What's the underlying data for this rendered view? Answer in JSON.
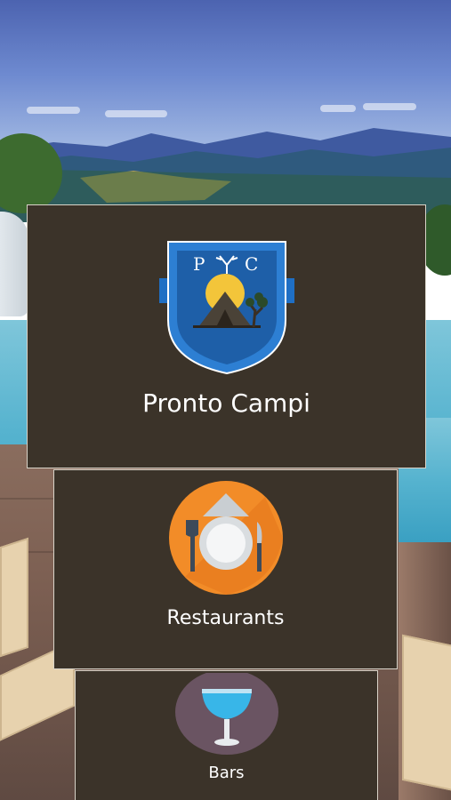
{
  "menu": {
    "items": [
      {
        "label": "Pronto Campi",
        "icon": "campground-crest-icon"
      },
      {
        "label": "Restaurants",
        "icon": "restaurant-plate-icon"
      },
      {
        "label": "Bars",
        "icon": "cocktail-glass-icon"
      }
    ],
    "logo_text": "PC"
  },
  "colors": {
    "card_background": "#3b3329",
    "card_border": "#d8d3c8",
    "label_color": "#ffffff",
    "logo_blue": "#1f6fc4",
    "restaurant_orange": "#f28c28",
    "bar_purple": "#6a5462"
  }
}
